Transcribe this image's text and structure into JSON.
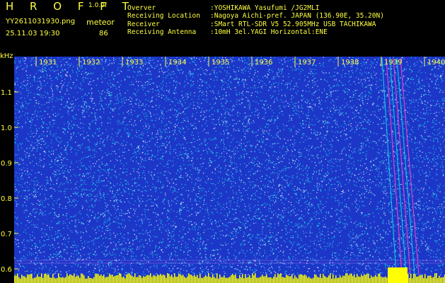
{
  "app": {
    "title": "H R O F F T",
    "version": "1.0.0f"
  },
  "file": {
    "name": "YY2611031930.png",
    "datetime": "25.11.03 19:30"
  },
  "detection": {
    "label": "meteor",
    "count": "86"
  },
  "station": {
    "rows": [
      {
        "key": "Overver",
        "value": ":YOSHIKAWA Yasufumi /JG2MLI"
      },
      {
        "key": "Receiving Location",
        "value": ":Nagoya Aichi-pref. JAPAN (136.90E, 35.20N)"
      },
      {
        "key": "Receiver",
        "value": ":SMart RTL-SDR V5 52.905MHz USB TACHIKAWA"
      },
      {
        "key": "Receiving Antenna",
        "value": ":10mH 3el.YAGI Horizontal:ENE"
      }
    ]
  },
  "spectrogram": {
    "freq_unit": "kHz",
    "freq_ticks": [
      "1.1",
      "1.0",
      "0.9",
      "0.8",
      "0.7",
      "0.6"
    ],
    "time_ticks": [
      "1931",
      "1932",
      "1933",
      "1934",
      "1935",
      "1936",
      "1937",
      "1938",
      "1939",
      "1940"
    ],
    "colors": {
      "background": "#1c37c8",
      "noise_cyan": "#18d0e8",
      "noise_light": "#55a8ff",
      "noise_white": "#e8f0ff",
      "label": "#ffff40",
      "trail": "#ff44cc"
    }
  }
}
